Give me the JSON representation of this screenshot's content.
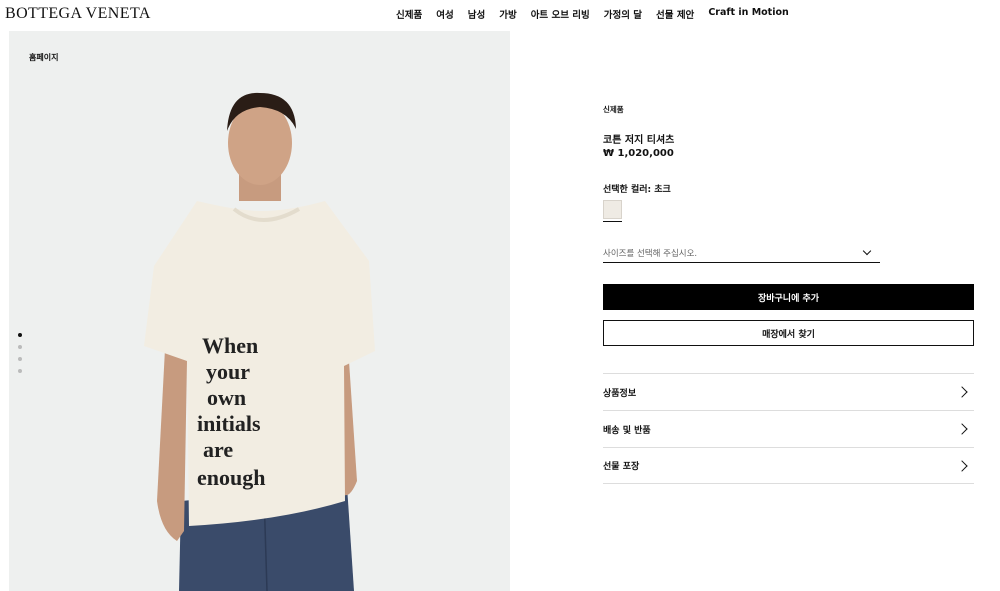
{
  "header": {
    "logo": "BOTTEGA VENETA",
    "nav": [
      "신제품",
      "여성",
      "남성",
      "가방",
      "아트 오브 리빙",
      "가정의 달",
      "선물 제안",
      "Craft in Motion"
    ]
  },
  "gallery": {
    "breadcrumb": "홈페이지",
    "shirt_text": [
      "When",
      "your",
      "own",
      "initials",
      "are",
      "enough"
    ],
    "dots_count": 4,
    "active_index": 0
  },
  "product": {
    "tag": "신제품",
    "name": "코튼 저지 티셔츠",
    "price": "₩ 1,020,000",
    "color_label": "선택한 컬러: 초크",
    "size_placeholder": "사이즈를 선택해 주십시오.",
    "add_to_cart": "장바구니에 추가",
    "find_in_store": "매장에서 찾기"
  },
  "accordion": [
    "상품정보",
    "배송 및 반품",
    "선물 포장"
  ],
  "colors": {
    "swatch": "#efebe4",
    "background": "#eef0ef",
    "shirt": "#f2ede2",
    "jeans": "#3a4b6a",
    "skin": "#c79b7f"
  }
}
